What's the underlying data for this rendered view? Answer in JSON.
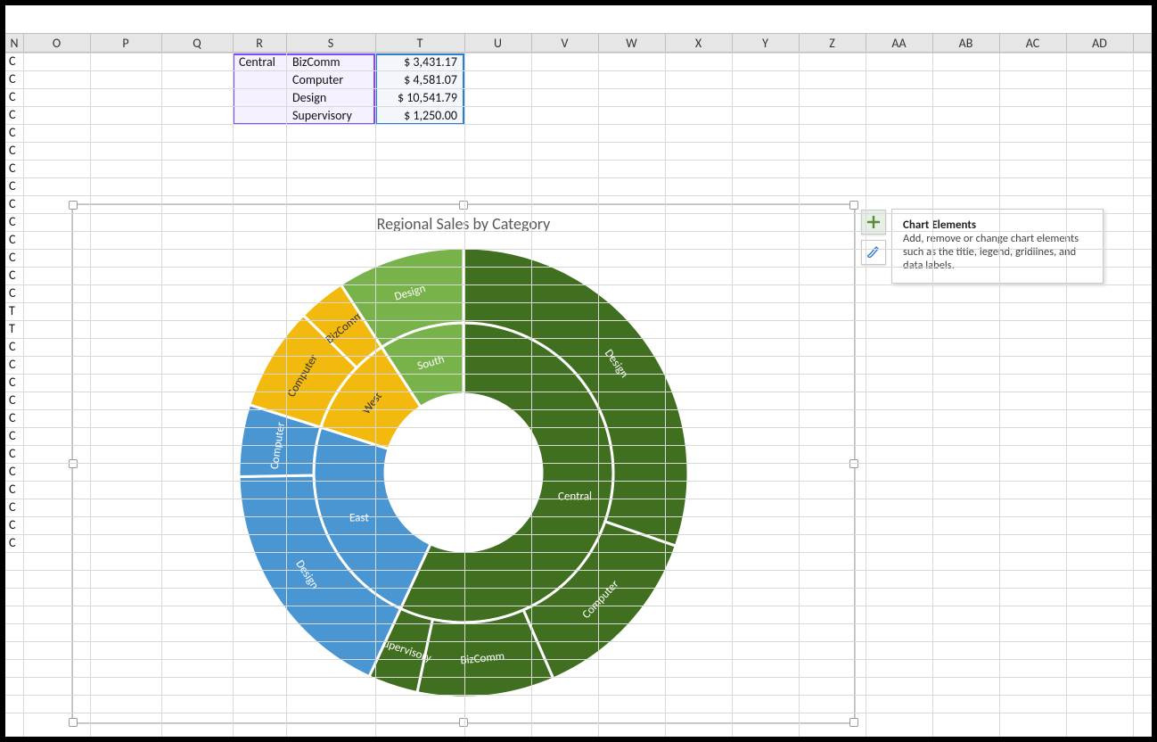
{
  "columns": [
    "N",
    "O",
    "P",
    "Q",
    "R",
    "S",
    "T",
    "U",
    "V",
    "W",
    "X",
    "Y",
    "Z",
    "AA",
    "AB",
    "AC",
    "AD"
  ],
  "row_labels": [
    "C",
    "C",
    "C",
    "C",
    "C",
    "C",
    "C",
    "C",
    "C",
    "C",
    "C",
    "C",
    "C",
    "C",
    "T",
    "T",
    "C",
    "C",
    "C",
    "C",
    "C",
    "C",
    "C",
    "C",
    "C",
    "C",
    "C",
    "C"
  ],
  "table": {
    "region": "Central",
    "rows": [
      {
        "cat": "BizComm",
        "val": "$  3,431.17"
      },
      {
        "cat": "Computer",
        "val": "$  4,581.07"
      },
      {
        "cat": "Design",
        "val": "$ 10,541.79"
      },
      {
        "cat": "Supervisory",
        "val": "$  1,250.00"
      }
    ]
  },
  "chart": {
    "title": "Regional Sales by Category",
    "inner_labels": [
      "Central",
      "East",
      "West",
      "South"
    ],
    "outer_labels": {
      "central": [
        "Design",
        "Computer",
        "BizComm",
        "Supervisory"
      ],
      "east": [
        "Design",
        "Computer"
      ],
      "west": [
        "Computer",
        "BizComm"
      ],
      "south": [
        "Design"
      ]
    }
  },
  "tooltip": {
    "title": "Chart Elements",
    "body": "Add, remove or change chart elements such as the title, legend, gridlines, and data labels."
  },
  "chart_data": {
    "type": "sunburst",
    "title": "Regional Sales by Category",
    "hierarchy": [
      {
        "name": "Central",
        "color": "#3f6f1f",
        "children": [
          {
            "name": "Design",
            "value": 10541.79
          },
          {
            "name": "Computer",
            "value": 4581.07
          },
          {
            "name": "BizComm",
            "value": 3431.17
          },
          {
            "name": "Supervisory",
            "value": 1250.0
          }
        ]
      },
      {
        "name": "East",
        "color": "#4a96d2",
        "children": [
          {
            "name": "Design",
            "value": 6200
          },
          {
            "name": "Computer",
            "value": 1800
          }
        ]
      },
      {
        "name": "West",
        "color": "#f2b90f",
        "children": [
          {
            "name": "Computer",
            "value": 2600
          },
          {
            "name": "BizComm",
            "value": 1200
          }
        ]
      },
      {
        "name": "South",
        "color": "#78b24a",
        "children": [
          {
            "name": "Design",
            "value": 3200
          }
        ]
      }
    ]
  }
}
